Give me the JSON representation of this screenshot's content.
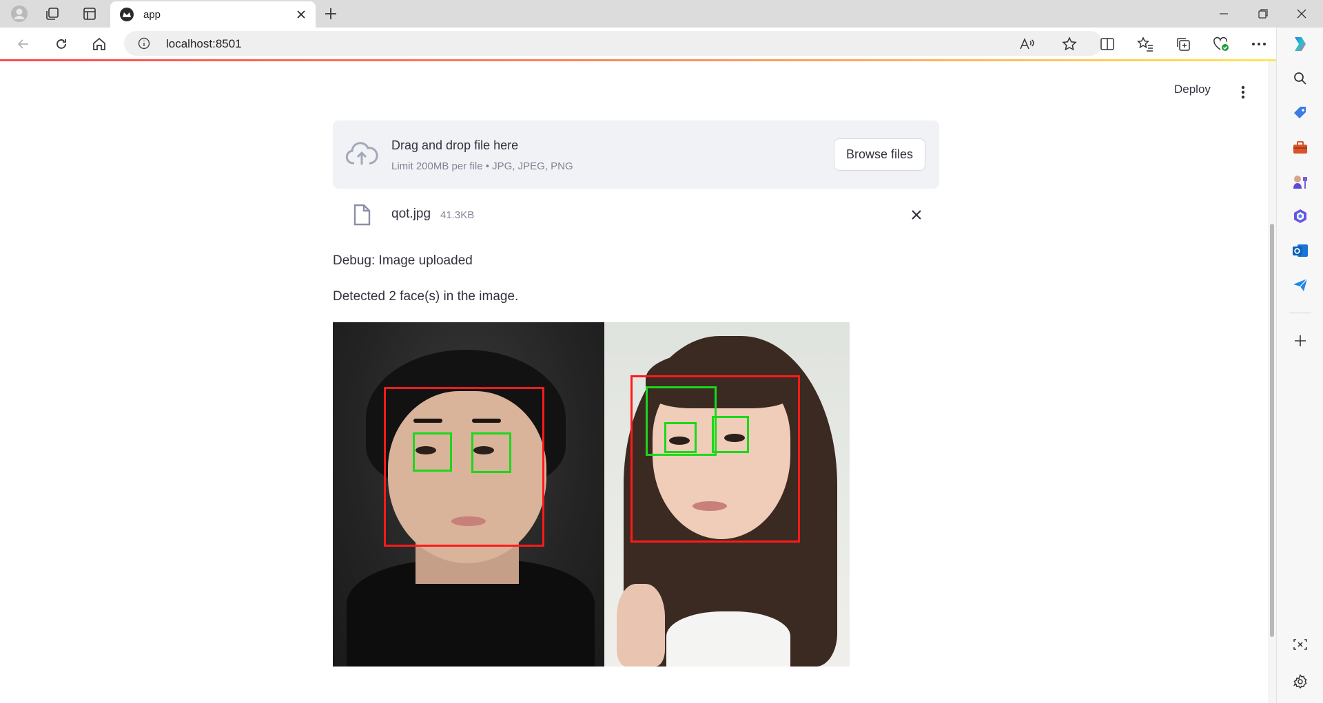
{
  "browser": {
    "tab_title": "app",
    "url": "localhost:8501"
  },
  "app": {
    "deploy_label": "Deploy",
    "uploader": {
      "title": "Drag and drop file here",
      "limit_text": "Limit 200MB per file • JPG, JPEG, PNG",
      "browse_label": "Browse files"
    },
    "uploaded_file": {
      "name": "qot.jpg",
      "size": "41.3KB"
    },
    "debug_text": "Debug: Image uploaded",
    "detection_text": "Detected 2 face(s) in the image."
  },
  "colors": {
    "face_box": "#ff1a1a",
    "eye_box": "#1bd81b",
    "accent": "#ff4b4b"
  }
}
